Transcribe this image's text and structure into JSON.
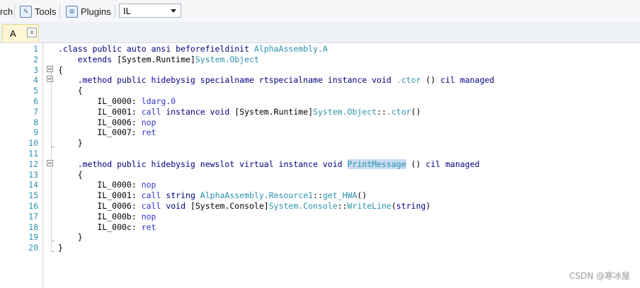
{
  "toolbar": {
    "search_partial": "rch",
    "tools_label": "Tools",
    "plugins_label": "Plugins",
    "language_select": "IL"
  },
  "tab": {
    "label": "A",
    "close": "x"
  },
  "code_lines": [
    {
      "n": "1",
      "segs": [
        {
          "t": ".class public auto ansi beforefieldinit ",
          "c": "kw"
        },
        {
          "t": "AlphaAssembly.A",
          "c": "ty"
        }
      ]
    },
    {
      "n": "2",
      "segs": [
        {
          "t": "    extends ",
          "c": "kw"
        },
        {
          "t": "[System.Runtime]",
          "c": ""
        },
        {
          "t": "System.Object",
          "c": "ty"
        }
      ]
    },
    {
      "n": "3",
      "segs": [
        {
          "t": "{",
          "c": ""
        }
      ]
    },
    {
      "n": "4",
      "segs": [
        {
          "t": "    .method public hidebysig specialname rtspecialname instance void ",
          "c": "kw"
        },
        {
          "t": ".ctor",
          "c": "ty"
        },
        {
          "t": " () ",
          "c": ""
        },
        {
          "t": "cil managed",
          "c": "kw"
        }
      ]
    },
    {
      "n": "5",
      "segs": [
        {
          "t": "    {",
          "c": ""
        }
      ]
    },
    {
      "n": "6",
      "segs": [
        {
          "t": "        IL_0000: ",
          "c": ""
        },
        {
          "t": "ldarg.0",
          "c": "op"
        }
      ]
    },
    {
      "n": "7",
      "segs": [
        {
          "t": "        IL_0001: ",
          "c": ""
        },
        {
          "t": "call",
          "c": "op"
        },
        {
          "t": " instance void ",
          "c": "kw"
        },
        {
          "t": "[System.Runtime]",
          "c": ""
        },
        {
          "t": "System.Object",
          "c": "ty"
        },
        {
          "t": "::",
          "c": ""
        },
        {
          "t": ".ctor",
          "c": "ty"
        },
        {
          "t": "()",
          "c": ""
        }
      ]
    },
    {
      "n": "8",
      "segs": [
        {
          "t": "        IL_0006: ",
          "c": ""
        },
        {
          "t": "nop",
          "c": "op"
        }
      ]
    },
    {
      "n": "9",
      "segs": [
        {
          "t": "        IL_0007: ",
          "c": ""
        },
        {
          "t": "ret",
          "c": "op"
        }
      ]
    },
    {
      "n": "10",
      "segs": [
        {
          "t": "    }",
          "c": ""
        }
      ]
    },
    {
      "n": "11",
      "segs": [
        {
          "t": "",
          "c": ""
        }
      ]
    },
    {
      "n": "12",
      "segs": [
        {
          "t": "    .method public hidebysig newslot virtual instance void ",
          "c": "kw"
        },
        {
          "t": "PrintMessage",
          "c": "hl"
        },
        {
          "t": " () ",
          "c": ""
        },
        {
          "t": "cil managed",
          "c": "kw"
        }
      ]
    },
    {
      "n": "13",
      "segs": [
        {
          "t": "    {",
          "c": ""
        }
      ]
    },
    {
      "n": "14",
      "segs": [
        {
          "t": "        IL_0000: ",
          "c": ""
        },
        {
          "t": "nop",
          "c": "op"
        }
      ]
    },
    {
      "n": "15",
      "segs": [
        {
          "t": "        IL_0001: ",
          "c": ""
        },
        {
          "t": "call",
          "c": "op"
        },
        {
          "t": " string ",
          "c": "kw"
        },
        {
          "t": "AlphaAssembly.Resource1",
          "c": "ty"
        },
        {
          "t": "::",
          "c": ""
        },
        {
          "t": "get_HWA",
          "c": "ty"
        },
        {
          "t": "()",
          "c": ""
        }
      ]
    },
    {
      "n": "16",
      "segs": [
        {
          "t": "        IL_0006: ",
          "c": ""
        },
        {
          "t": "call",
          "c": "op"
        },
        {
          "t": " void ",
          "c": "kw"
        },
        {
          "t": "[System.Console]",
          "c": ""
        },
        {
          "t": "System.Console",
          "c": "ty"
        },
        {
          "t": "::",
          "c": ""
        },
        {
          "t": "WriteLine",
          "c": "ty"
        },
        {
          "t": "(",
          "c": ""
        },
        {
          "t": "string",
          "c": "kw"
        },
        {
          "t": ")",
          "c": ""
        }
      ]
    },
    {
      "n": "17",
      "segs": [
        {
          "t": "        IL_000b: ",
          "c": ""
        },
        {
          "t": "nop",
          "c": "op"
        }
      ]
    },
    {
      "n": "18",
      "segs": [
        {
          "t": "        IL_000c: ",
          "c": ""
        },
        {
          "t": "ret",
          "c": "op"
        }
      ]
    },
    {
      "n": "19",
      "segs": [
        {
          "t": "    }",
          "c": ""
        }
      ]
    },
    {
      "n": "20",
      "segs": [
        {
          "t": "}",
          "c": ""
        }
      ]
    }
  ],
  "watermark": "CSDN @寒冰屋",
  "colors": {
    "keyword": "#000080",
    "type": "#2b91af",
    "opcode": "#3333cc",
    "line_number": "#2b91af",
    "highlight": "#c7dcf1"
  }
}
